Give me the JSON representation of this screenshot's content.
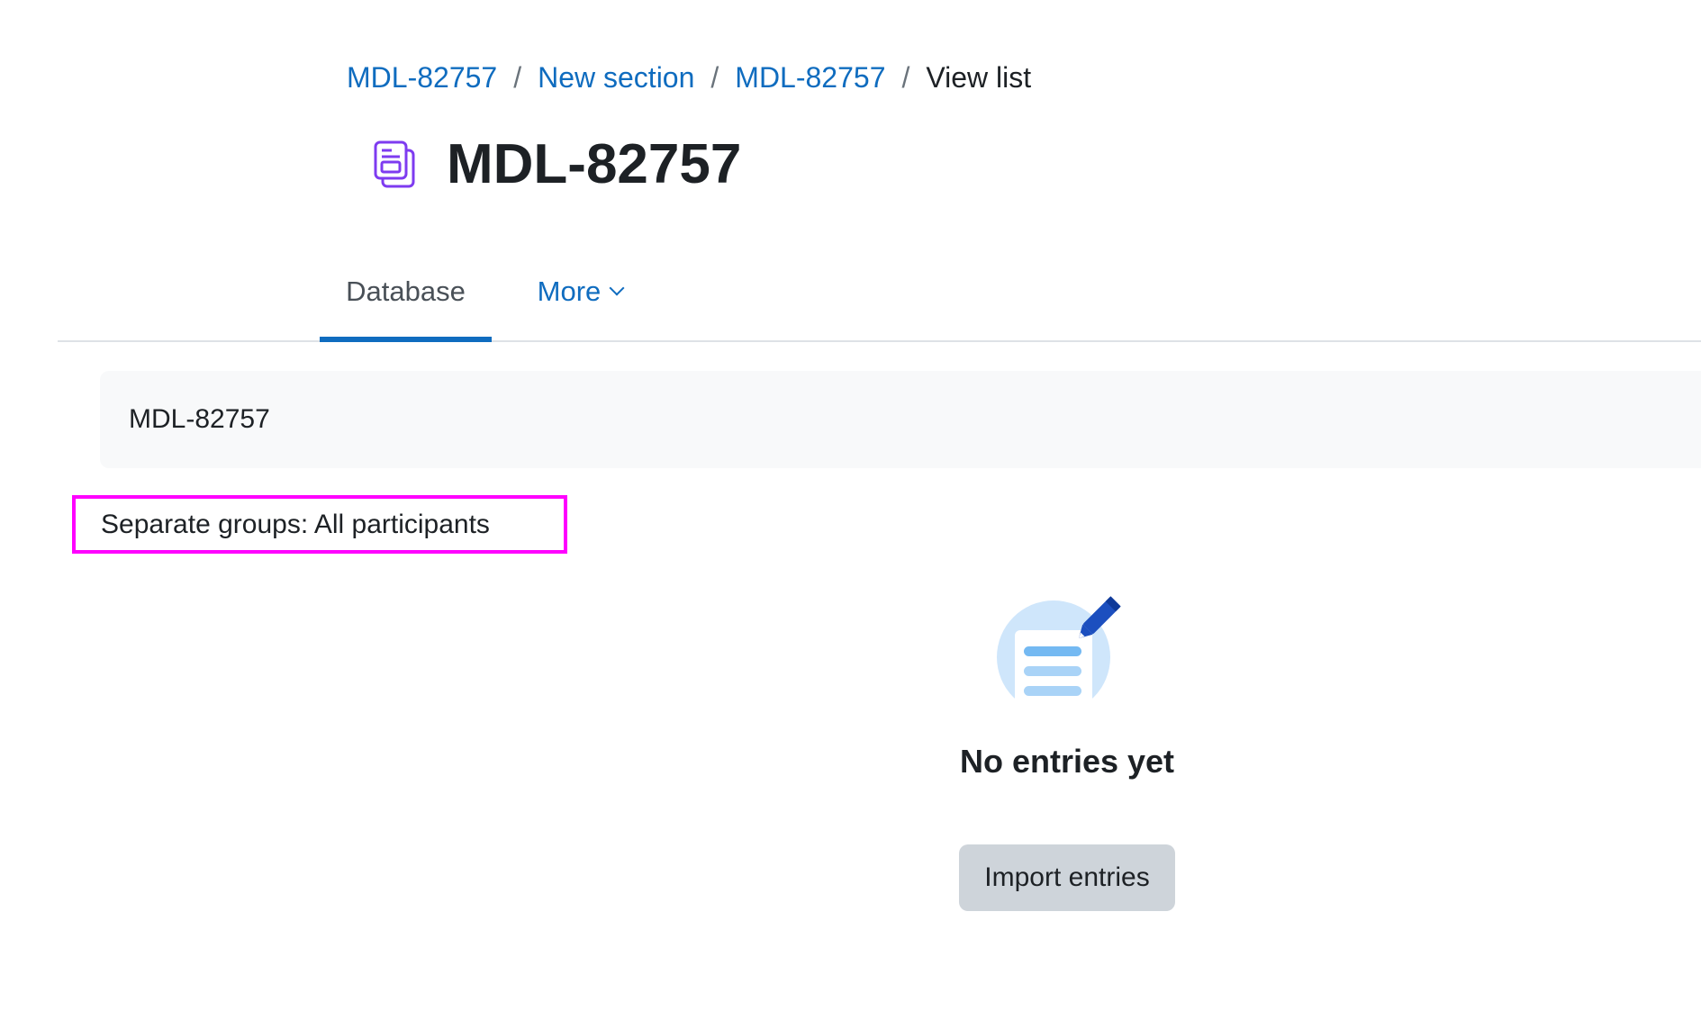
{
  "breadcrumb": {
    "items": [
      {
        "label": "MDL-82757",
        "link": true
      },
      {
        "label": "New section",
        "link": true
      },
      {
        "label": "MDL-82757",
        "link": true
      },
      {
        "label": "View list",
        "link": false
      }
    ],
    "separator": "/"
  },
  "header": {
    "title": "MDL-82757",
    "icon": "database-activity-icon",
    "icon_color": "#7e3bf0"
  },
  "nav": {
    "tabs": [
      {
        "label": "Database",
        "active": true
      },
      {
        "label": "More",
        "dropdown": true
      }
    ]
  },
  "intro": {
    "text": "MDL-82757"
  },
  "groups": {
    "text": "Separate groups: All participants"
  },
  "empty_state": {
    "icon": "no-entries-illustration-icon",
    "heading": "No entries yet",
    "button_label": "Import entries"
  },
  "colors": {
    "link": "#0f6cbf",
    "active_tab_bar": "#0f6cbf",
    "highlight_border": "#ff00ff",
    "button_bg": "#ced4da",
    "intro_bg": "#f8f9fa"
  }
}
